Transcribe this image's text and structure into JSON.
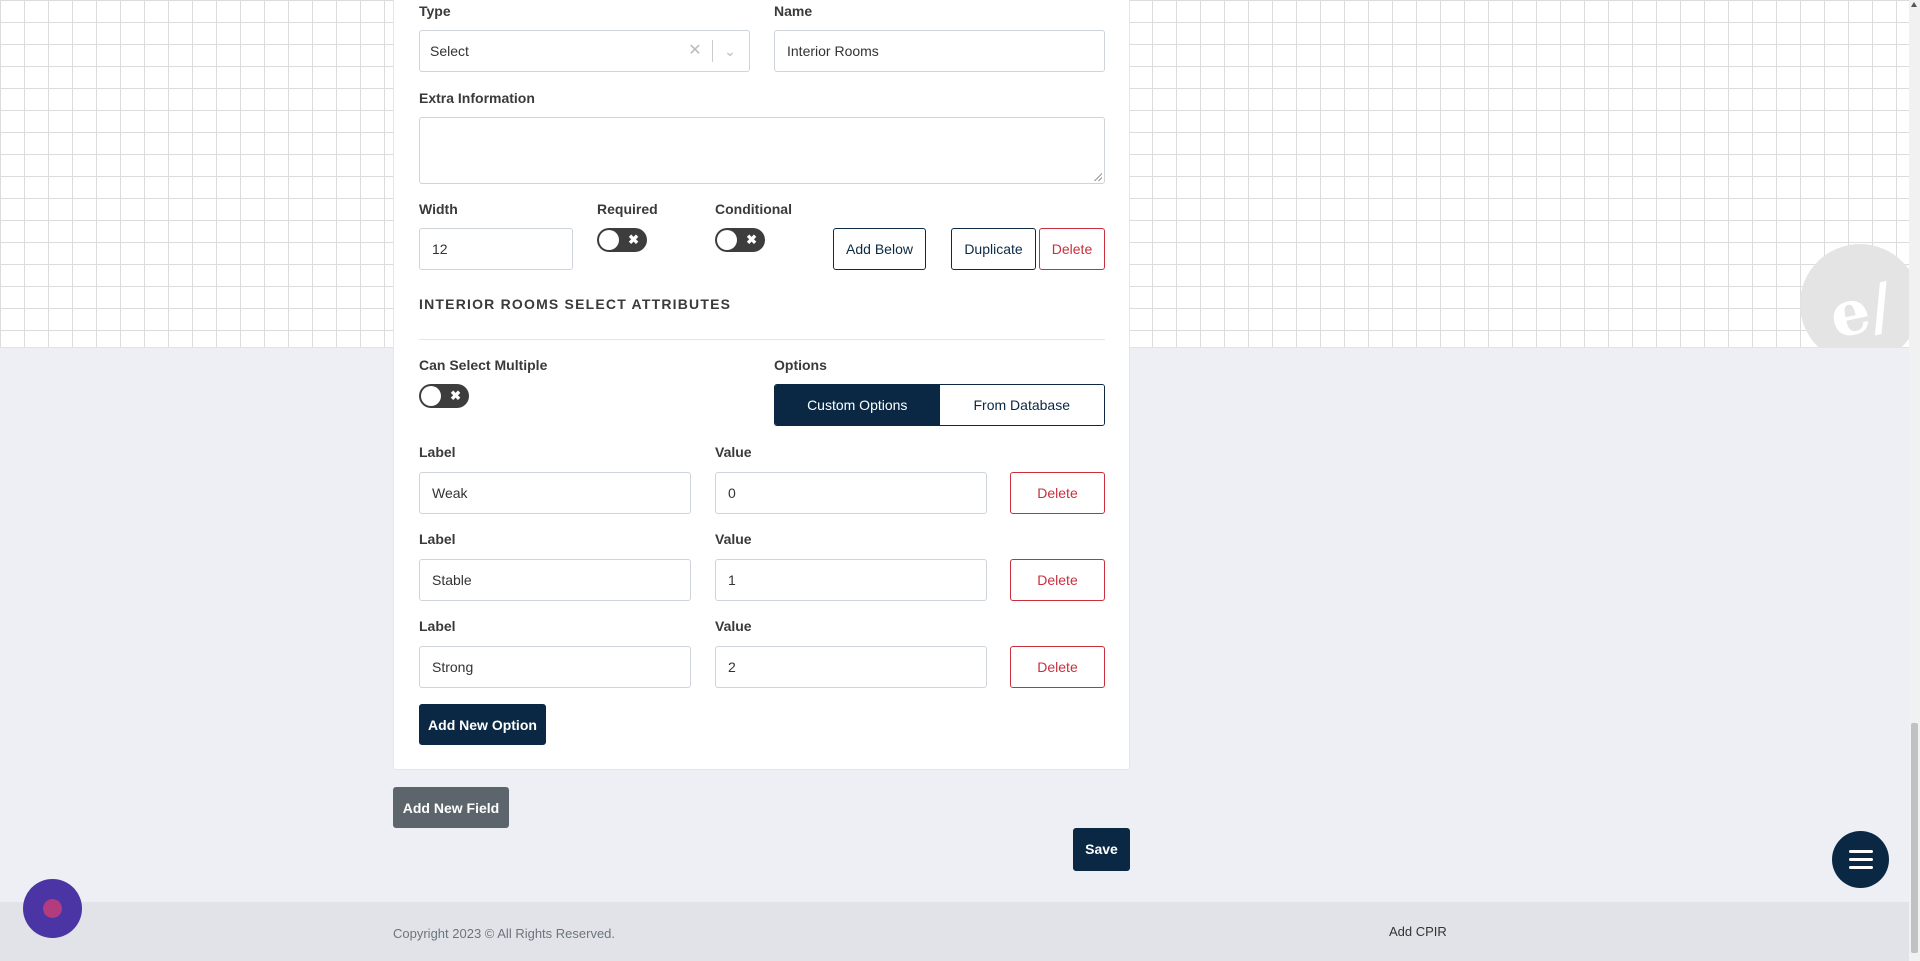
{
  "field": {
    "type_label": "Type",
    "type_value": "Select",
    "name_label": "Name",
    "name_value": "Interior Rooms",
    "extra_label": "Extra Information",
    "width_label": "Width",
    "width_value": "12",
    "required_label": "Required",
    "conditional_label": "Conditional",
    "add_below": "Add Below",
    "duplicate": "Duplicate",
    "delete": "Delete"
  },
  "attributes": {
    "title": "INTERIOR ROOMS SELECT ATTRIBUTES",
    "multiple_label": "Can Select Multiple",
    "options_label": "Options",
    "custom_options": "Custom Options",
    "from_database": "From Database"
  },
  "options": [
    {
      "label_caption": "Label",
      "label": "Weak",
      "value_caption": "Value",
      "value": "0",
      "delete": "Delete"
    },
    {
      "label_caption": "Label",
      "label": "Stable",
      "value_caption": "Value",
      "value": "1",
      "delete": "Delete"
    },
    {
      "label_caption": "Label",
      "label": "Strong",
      "value_caption": "Value",
      "value": "2",
      "delete": "Delete"
    }
  ],
  "actions": {
    "add_option": "Add New Option",
    "add_field": "Add New Field",
    "save": "Save"
  },
  "footer": {
    "copyright": "Copyright 2023 © All Rights Reserved.",
    "link": "Add CPIR"
  },
  "colors": {
    "primary": "#0a2843",
    "danger": "#c9303e",
    "toggle_off": "#3d3d3d"
  },
  "icons": {
    "clear": "close-icon",
    "dropdown": "chevron-down-icon",
    "menu": "hamburger-icon",
    "chat": "chat-icon"
  }
}
